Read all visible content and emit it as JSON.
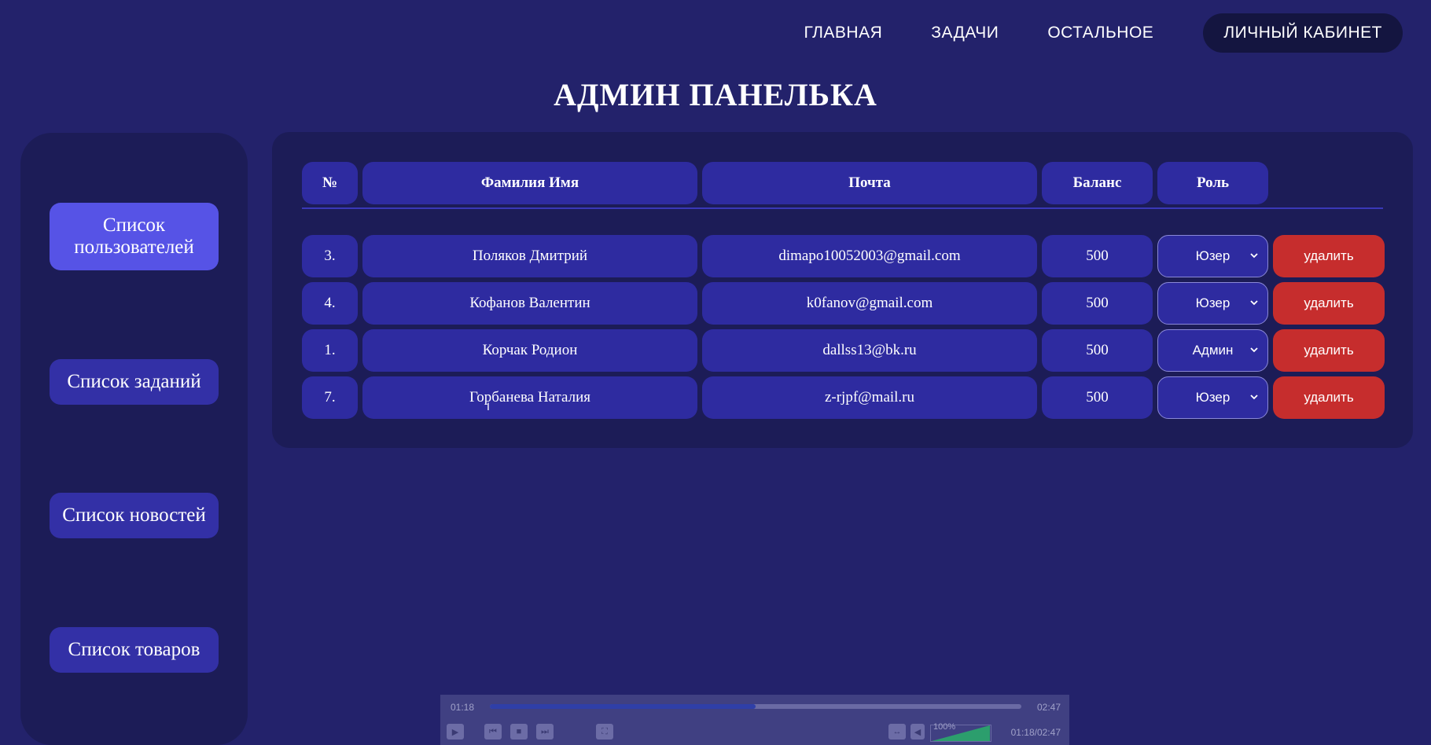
{
  "nav": {
    "home": "ГЛАВНАЯ",
    "tasks": "ЗАДАЧИ",
    "other": "ОСТАЛЬНОЕ",
    "cabinet": "ЛИЧНЫЙ КАБИНЕТ"
  },
  "title": "АДМИН ПАНЕЛЬКА",
  "sidebar": {
    "items": [
      {
        "label": "Список пользователей",
        "active": true
      },
      {
        "label": "Список заданий",
        "active": false
      },
      {
        "label": "Список новостей",
        "active": false
      },
      {
        "label": "Список товаров",
        "active": false
      }
    ]
  },
  "table": {
    "headers": {
      "num": "№",
      "name": "Фамилия Имя",
      "mail": "Почта",
      "balance": "Баланс",
      "role": "Роль"
    },
    "delete_label": "удалить",
    "rows": [
      {
        "num": "3.",
        "name": "Поляков Дмитрий",
        "mail": "dimapo10052003@gmail.com",
        "balance": "500",
        "role": "Юзер"
      },
      {
        "num": "4.",
        "name": "Кофанов Валентин",
        "mail": "k0fanov@gmail.com",
        "balance": "500",
        "role": "Юзер"
      },
      {
        "num": "1.",
        "name": "Корчак Родион",
        "mail": "dallss13@bk.ru",
        "balance": "500",
        "role": "Админ"
      },
      {
        "num": "7.",
        "name": "Горбанева Наталия",
        "mail": "z-rjpf@mail.ru",
        "balance": "500",
        "role": "Юзер"
      }
    ]
  },
  "player": {
    "current": "01:18",
    "total": "02:47",
    "combined": "01:18/02:47",
    "volume": "100%",
    "progress": 0.5
  },
  "colors": {
    "background": "#23226b",
    "panel": "#1c1c57",
    "cell": "#2e2ba0",
    "active": "#5653e6",
    "danger": "#c62d2d"
  }
}
